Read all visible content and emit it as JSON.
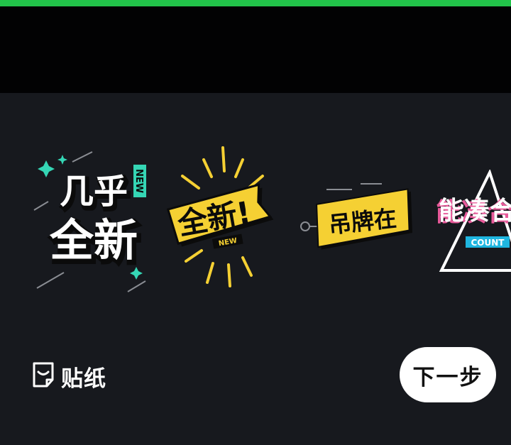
{
  "theme": {
    "accent": "#22c44a",
    "preview_bg": "#020203",
    "panel_bg": "#17191e",
    "sticker_yellow": "#f5d033",
    "sticker_teal": "#35d6b5"
  },
  "stickers": [
    {
      "main_top": "几乎",
      "main_bottom": "全新",
      "tag": "NEW"
    },
    {
      "main": "全新!",
      "tag": "NEW"
    },
    {
      "main": "吊牌在"
    },
    {
      "main": "能凑合",
      "tag": "COUNT"
    }
  ],
  "bottom_bar": {
    "tab_label": "贴纸",
    "tab_icon": "sticker-icon",
    "next_label": "下一步"
  }
}
